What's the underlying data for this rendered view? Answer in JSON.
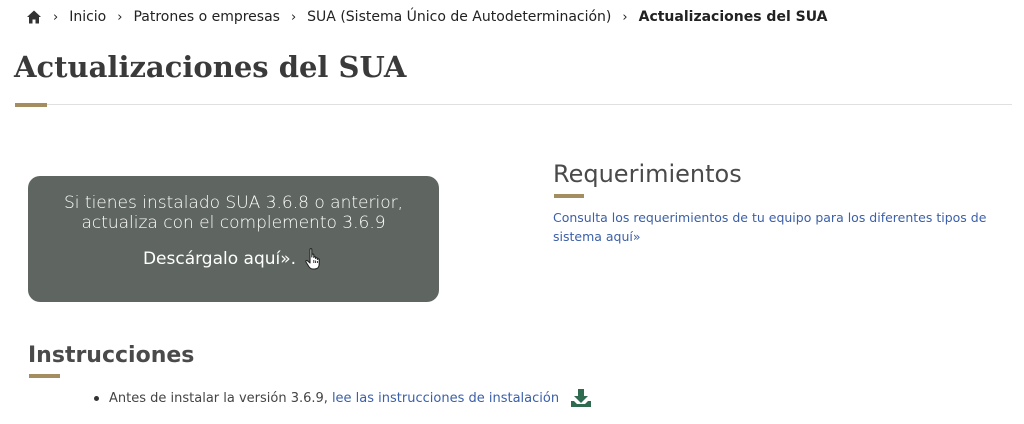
{
  "breadcrumb": {
    "home_icon": "home-icon",
    "items": [
      {
        "label": "Inicio"
      },
      {
        "label": "Patrones o empresas"
      },
      {
        "label": "SUA (Sistema Único de Autodeterminación)"
      }
    ],
    "current": "Actualizaciones del SUA"
  },
  "page": {
    "title": "Actualizaciones del SUA",
    "accent_color": "#a58d62"
  },
  "promo": {
    "line1": "Si tienes instalado SUA 3.6.8 o anterior,",
    "line2": "actualiza con el complemento 3.6.9",
    "cta": "Descárgalo aquí».",
    "cursor_icon": "hand-pointer-icon",
    "background": "#5f6661"
  },
  "requerimientos": {
    "title": "Requerimientos",
    "link": "Consulta los requerimientos de tu equipo para los diferentes tipos de sistema aquí»"
  },
  "instrucciones": {
    "title": "Instrucciones",
    "items": [
      {
        "text": "Antes de instalar la versión 3.6.9,",
        "link": "lee las instrucciones de instalación",
        "icon": "download-icon"
      }
    ]
  }
}
